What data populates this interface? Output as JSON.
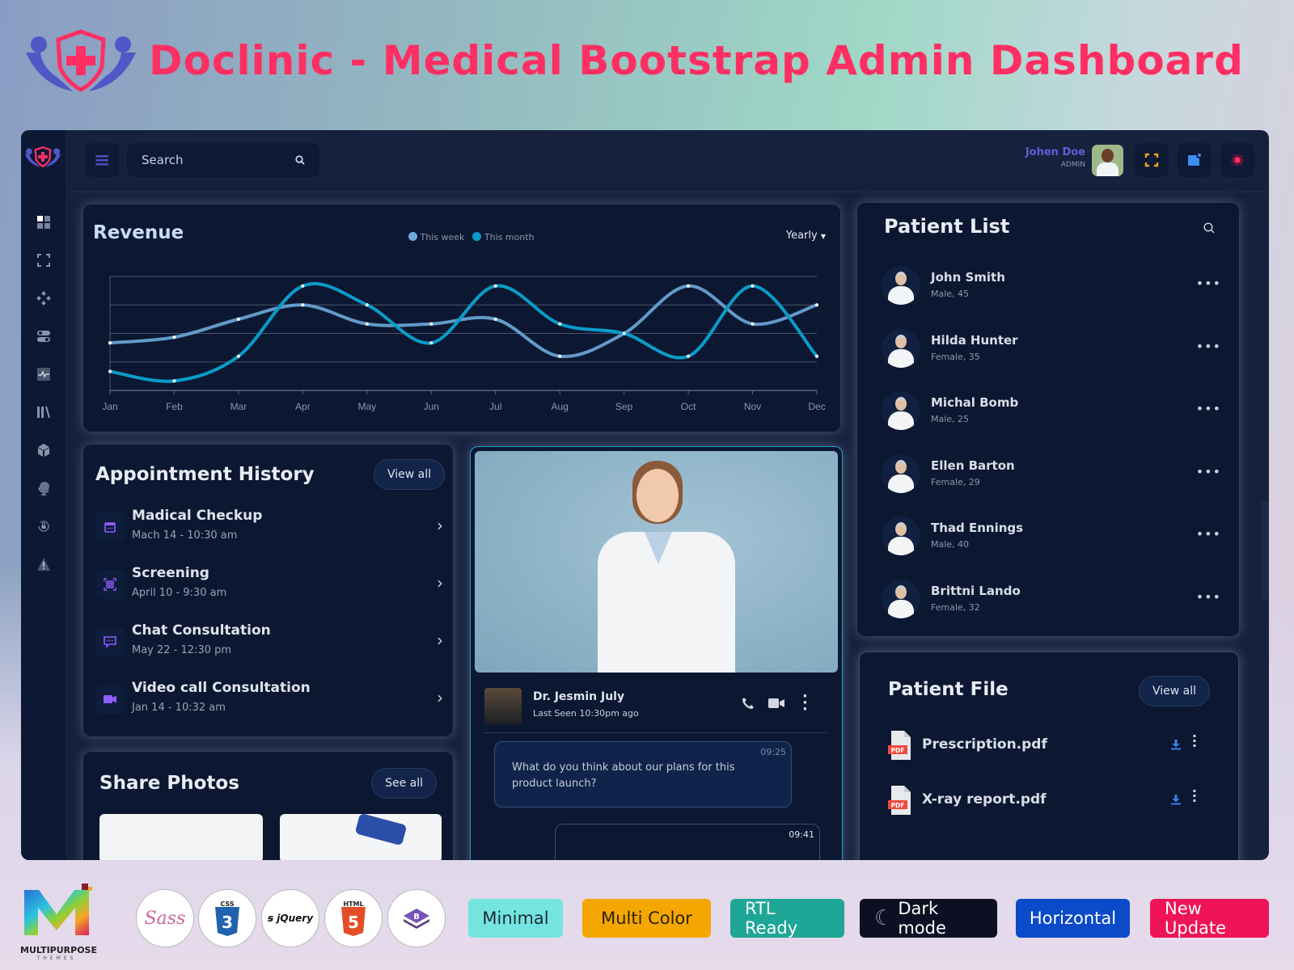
{
  "promo": {
    "title": "Doclinic - Medical Bootstrap Admin Dashboard"
  },
  "topbar": {
    "search_placeholder": "Search",
    "user_name": "Johen Doe",
    "user_role": "ADMIN"
  },
  "sidebar": {
    "items": [
      {
        "icon": "dashboard-icon"
      },
      {
        "icon": "expand-icon"
      },
      {
        "icon": "components-icon"
      },
      {
        "icon": "toggle-icon"
      },
      {
        "icon": "pulse-icon"
      },
      {
        "icon": "library-icon"
      },
      {
        "icon": "cube-icon"
      },
      {
        "icon": "globe-icon"
      },
      {
        "icon": "lock-rotate-icon"
      },
      {
        "icon": "warning-icon"
      }
    ]
  },
  "revenue": {
    "title": "Revenue",
    "filter": "Yearly"
  },
  "chart_data": {
    "type": "line",
    "title": "Revenue",
    "categories": [
      "Jan",
      "Feb",
      "Mar",
      "Apr",
      "May",
      "Jun",
      "Jul",
      "Aug",
      "Sep",
      "Oct",
      "Nov",
      "Dec"
    ],
    "series": [
      {
        "name": "This week",
        "color": "#6da8dc",
        "values": [
          50,
          56,
          75,
          90,
          70,
          70,
          75,
          36,
          60,
          110,
          70,
          90
        ]
      },
      {
        "name": "This month",
        "color": "#0a9cc9",
        "values": [
          20,
          10,
          36,
          110,
          90,
          50,
          110,
          70,
          60,
          36,
          110,
          36
        ]
      }
    ],
    "ylim": [
      0,
      120
    ],
    "grid": true,
    "legend": "top-center",
    "xlabel": "",
    "ylabel": ""
  },
  "appointments": {
    "title": "Appointment History",
    "view_all": "View all",
    "items": [
      {
        "title": "Madical Checkup",
        "time": "Mach 14 - 10:30 am",
        "icon": "calendar-icon"
      },
      {
        "title": "Screening",
        "time": "April 10 - 9:30 am",
        "icon": "qr-scan-icon"
      },
      {
        "title": "Chat Consultation",
        "time": "May 22 - 12:30 pm",
        "icon": "chat-icon"
      },
      {
        "title": "Video call Consultation",
        "time": "Jan 14 - 10:32 am",
        "icon": "video-icon"
      }
    ]
  },
  "photos": {
    "title": "Share Photos",
    "see_all": "See all"
  },
  "chat": {
    "name": "Dr. Jesmin July",
    "last_seen": "Last Seen 10:30pm ago",
    "messages": [
      {
        "time": "09:25",
        "text": "What do you think about our plans for this product launch?"
      },
      {
        "time": "09:41",
        "text": ""
      }
    ]
  },
  "patients": {
    "title": "Patient List",
    "items": [
      {
        "name": "John Smith",
        "info": "Male, 45"
      },
      {
        "name": "Hilda Hunter",
        "info": "Female, 35"
      },
      {
        "name": "Michal Bomb",
        "info": "Male, 25"
      },
      {
        "name": "Ellen Barton",
        "info": "Female, 29"
      },
      {
        "name": "Thad Ennings",
        "info": "Male, 40"
      },
      {
        "name": "Brittni Lando",
        "info": "Female, 32"
      }
    ]
  },
  "files": {
    "title": "Patient File",
    "view_all": "View all",
    "items": [
      {
        "name": "Prescription.pdf",
        "type": "PDF"
      },
      {
        "name": "X-ray report.pdf",
        "type": "PDF"
      }
    ]
  },
  "brand": {
    "name": "MULTIPURPOSE",
    "sub": "THEMES"
  },
  "tech": [
    "Sass",
    "CSS3",
    "jQuery",
    "HTML5",
    "Bootstrap"
  ],
  "badges": [
    {
      "label": "Minimal",
      "bg": "#74e4e0",
      "fg": "#1b2a33"
    },
    {
      "label": "Multi Color",
      "bg": "#f4a700",
      "fg": "#2b2210"
    },
    {
      "label": "RTL Ready",
      "bg": "#1ea697",
      "fg": "#ffffff"
    },
    {
      "label": "Dark mode",
      "bg": "#0c1022",
      "fg": "#ffffff"
    },
    {
      "label": "Horizontal",
      "bg": "#0b4ac8",
      "fg": "#ffffff"
    },
    {
      "label": "New Update",
      "bg": "#ef1358",
      "fg": "#ffffff"
    }
  ]
}
